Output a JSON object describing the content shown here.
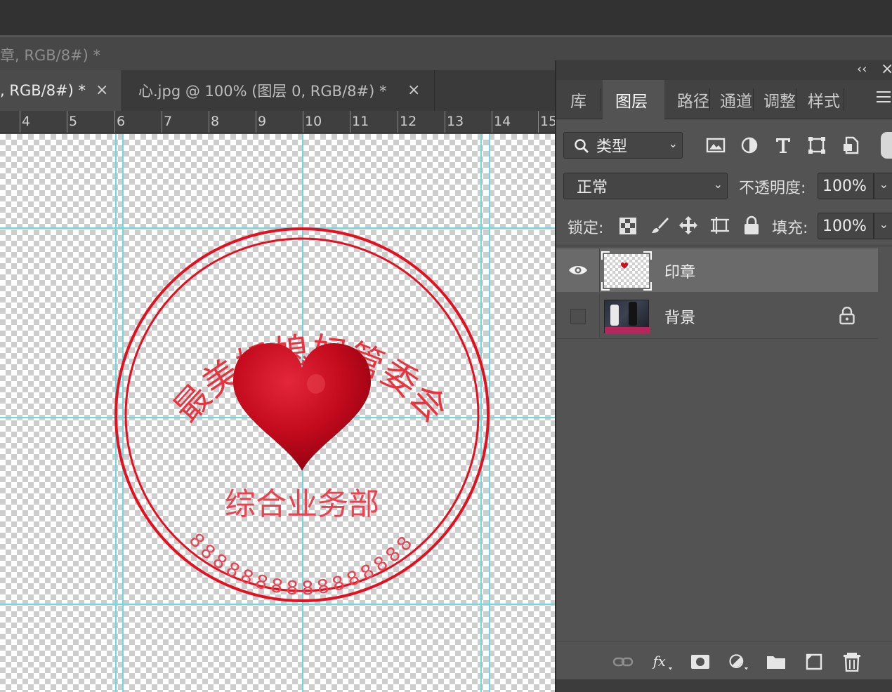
{
  "window": {
    "title_fragment": "章, RGB/8#) *"
  },
  "document_tabs": [
    {
      "label": ", RGB/8#) *",
      "close": "×"
    },
    {
      "label": "心.jpg @ 100% (图层 0, RGB/8#) *",
      "close": "×"
    }
  ],
  "ruler": {
    "labels": [
      "4",
      "5",
      "6",
      "7",
      "8",
      "9",
      "10",
      "11",
      "12",
      "13",
      "14",
      "15"
    ]
  },
  "stamp": {
    "arc_text": "最美好媳妇管委会",
    "center_text": "综合业务部",
    "bottom_text": "8888888888888888",
    "color": "#e4101f"
  },
  "panel": {
    "collapse_glyph": "‹‹",
    "close_glyph": "×",
    "tabs": [
      {
        "label": "库",
        "active": false
      },
      {
        "label": "图层",
        "active": true
      },
      {
        "label": "路径",
        "active": false
      },
      {
        "label": "通道",
        "active": false
      },
      {
        "label": "调整",
        "active": false
      },
      {
        "label": "样式",
        "active": false
      }
    ],
    "filter_kind": "类型",
    "blend_mode": "正常",
    "opacity_label": "不透明度:",
    "opacity_value": "100%",
    "lock_label": "锁定:",
    "fill_label": "填充:",
    "fill_value": "100%",
    "layers": [
      {
        "name": "印章",
        "visible": true,
        "selected": true,
        "locked": false
      },
      {
        "name": "背景",
        "visible": false,
        "selected": false,
        "locked": true
      }
    ]
  }
}
